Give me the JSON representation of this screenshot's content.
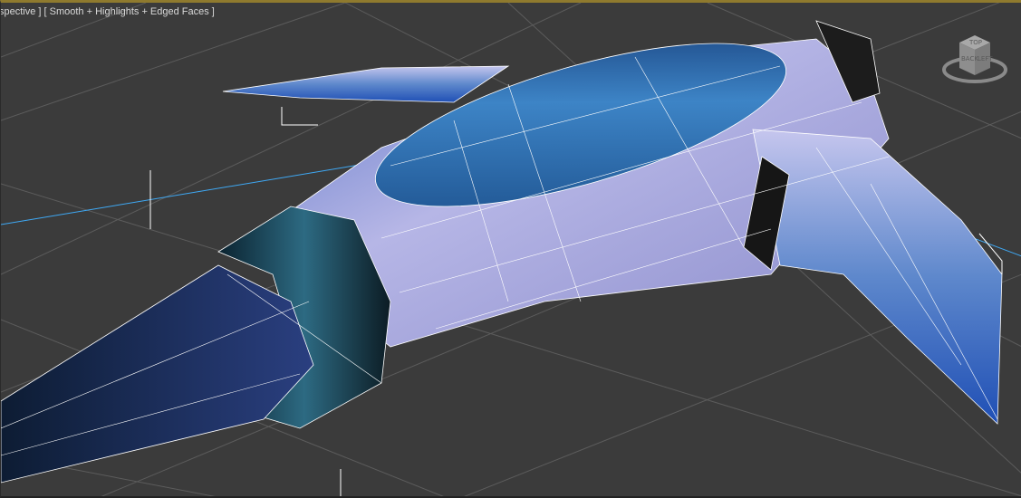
{
  "viewport": {
    "label": "spective ] [ Smooth + Highlights + Edged Faces ]",
    "view_name": "Perspective",
    "shading_mode": "Smooth + Highlights + Edged Faces"
  },
  "viewcube": {
    "top": "TOP",
    "back": "BACK",
    "left": "LEFT"
  },
  "colors": {
    "background": "#3b3b3b",
    "active_border": "#8f7a2e",
    "wire": "#ffffff",
    "grid": "#5a5a5a",
    "axis": "#3fa9f5"
  }
}
